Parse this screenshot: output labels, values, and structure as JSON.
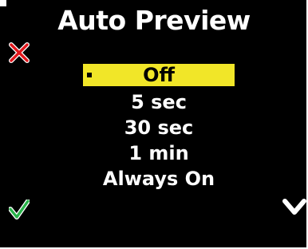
{
  "screen": {
    "title": "Auto Preview"
  },
  "menu": {
    "items": [
      {
        "label": "Off",
        "selected": true
      },
      {
        "label": "5 sec",
        "selected": false
      },
      {
        "label": "30 sec",
        "selected": false
      },
      {
        "label": "1 min",
        "selected": false
      },
      {
        "label": "Always On",
        "selected": false
      }
    ]
  },
  "icons": {
    "cancel": "close-x-icon",
    "confirm": "checkmark-icon",
    "scroll_down": "chevron-down-icon"
  },
  "colors": {
    "background": "#000000",
    "text": "#ffffff",
    "highlight": "#f1e628",
    "cancel": "#e0161b",
    "confirm": "#29b34a"
  }
}
